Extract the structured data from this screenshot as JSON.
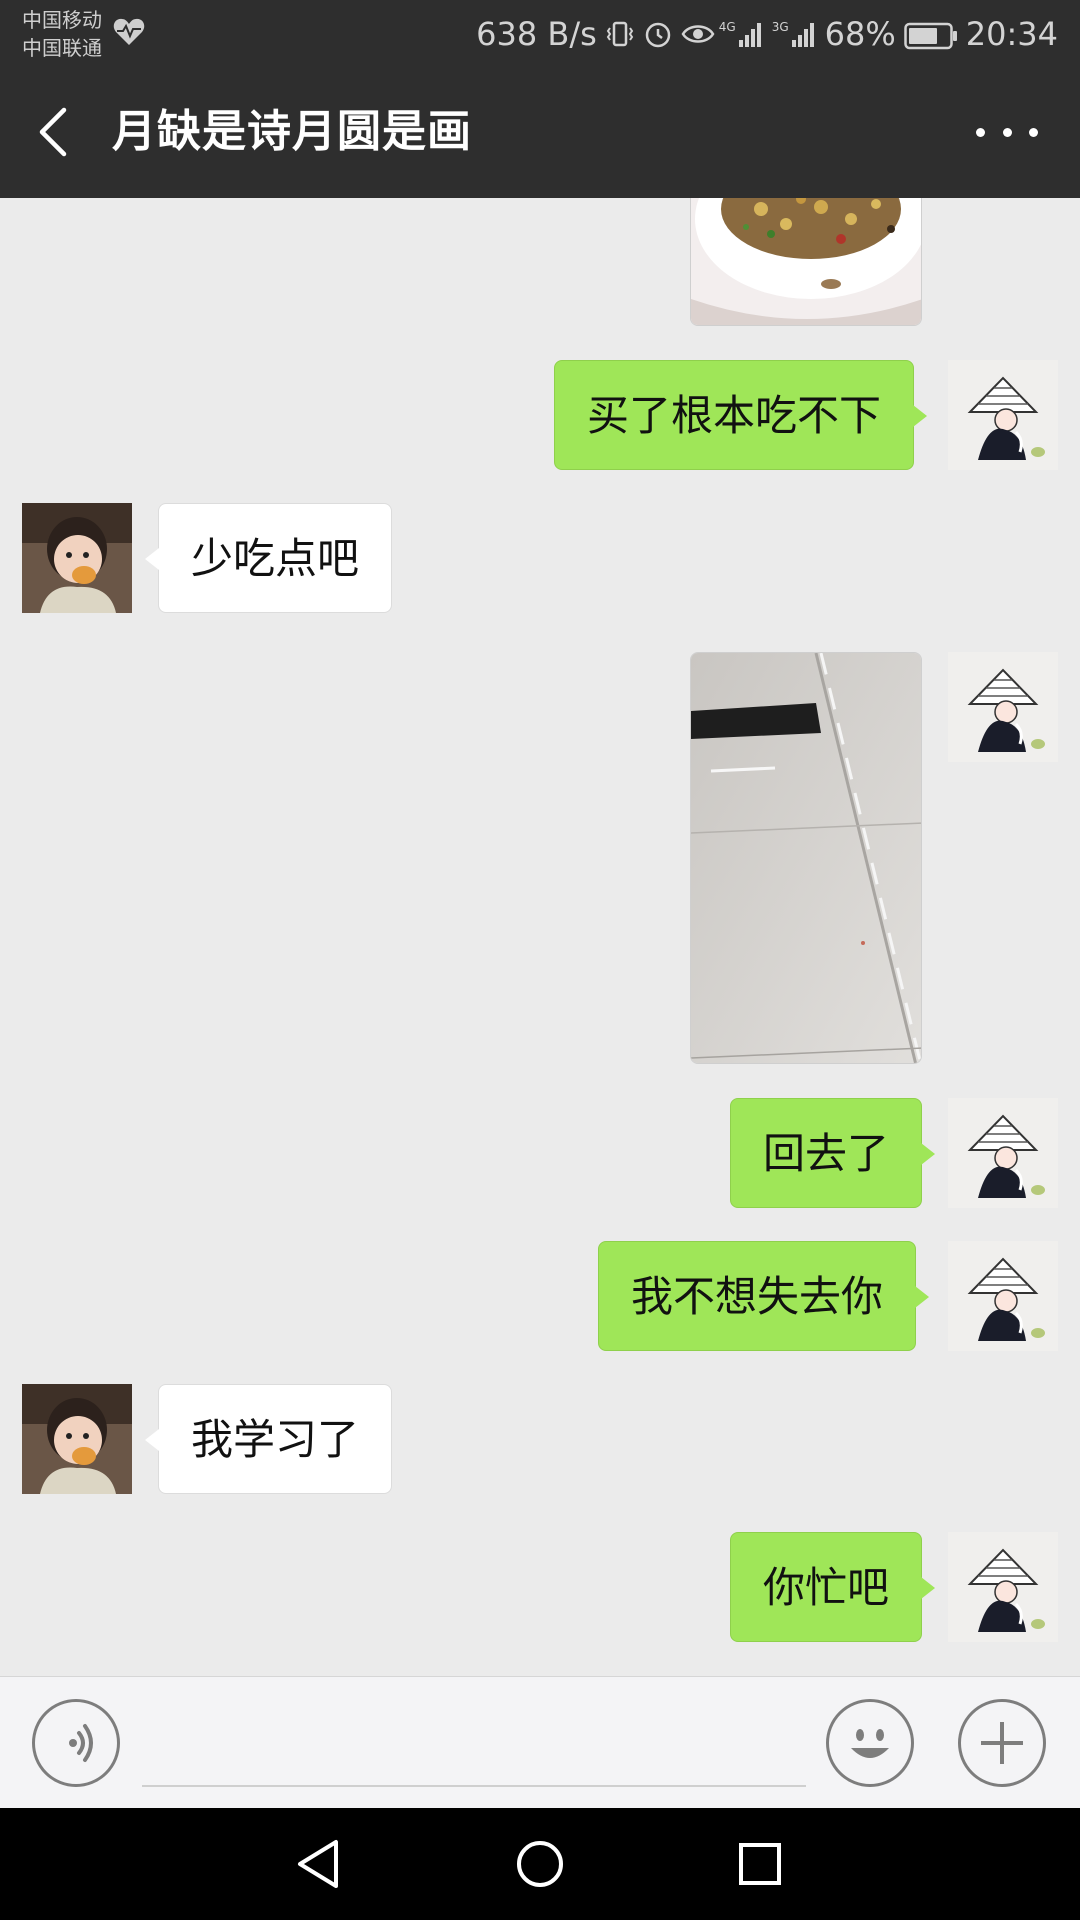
{
  "status_bar": {
    "carrier_1": "中国移动",
    "carrier_2": "中国联通",
    "net_speed": "638 B/s",
    "network_1": "4G",
    "network_2": "3G",
    "battery": "68%",
    "time": "20:34"
  },
  "header": {
    "title": "月缺是诗月圆是画",
    "more_icon": "more-dots-icon",
    "back_icon": "back-arrow-icon"
  },
  "messages": [
    {
      "type": "image",
      "from": "me",
      "content": "food-photo"
    },
    {
      "type": "text",
      "from": "me",
      "text": "买了根本吃不下"
    },
    {
      "type": "text",
      "from": "other",
      "text": "少吃点吧"
    },
    {
      "type": "image",
      "from": "me",
      "content": "floor-photo"
    },
    {
      "type": "text",
      "from": "me",
      "text": "回去了"
    },
    {
      "type": "text",
      "from": "me",
      "text": "我不想失去你"
    },
    {
      "type": "text",
      "from": "other",
      "text": "我学习了"
    },
    {
      "type": "text",
      "from": "me",
      "text": "你忙吧"
    }
  ],
  "input_bar": {
    "voice_icon": "voice-icon",
    "emoji_icon": "emoji-icon",
    "plus_icon": "plus-icon",
    "input_value": ""
  },
  "colors": {
    "header_bg": "#2e2e2e",
    "chat_bg": "#ebebeb",
    "sent_bubble": "#9fe658",
    "recv_bubble": "#ffffff"
  }
}
